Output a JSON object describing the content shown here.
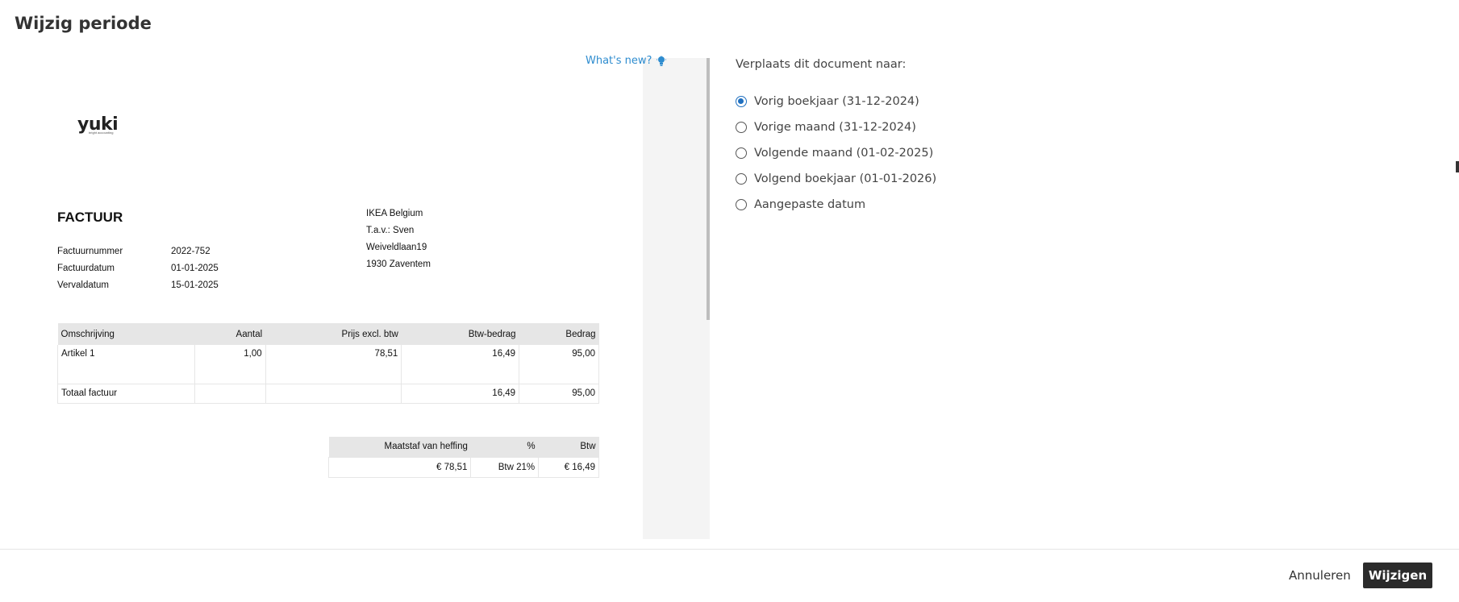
{
  "dialog": {
    "title": "Wijzig periode"
  },
  "whats_new": {
    "label": "What's new?",
    "icon": "lightbulb-icon"
  },
  "invoice": {
    "logo": "yuki",
    "logo_tagline": "bright accounting",
    "title": "FACTUUR",
    "meta": [
      {
        "key": "Factuurnummer",
        "value": "2022-752"
      },
      {
        "key": "Factuurdatum",
        "value": "01-01-2025"
      },
      {
        "key": "Vervaldatum",
        "value": "15-01-2025"
      }
    ],
    "address": [
      "IKEA Belgium",
      "T.a.v.: Sven",
      "Weiveldlaan19",
      "1930 Zaventem"
    ],
    "lines": {
      "headers": [
        "Omschrijving",
        "Aantal",
        "Prijs excl. btw",
        "Btw-bedrag",
        "Bedrag"
      ],
      "rows": [
        [
          "Artikel 1",
          "1,00",
          "78,51",
          "16,49",
          "95,00"
        ]
      ],
      "total": [
        "Totaal factuur",
        "",
        "",
        "16,49",
        "95,00"
      ]
    },
    "vat": {
      "headers": [
        "Maatstaf van heffing",
        "%",
        "Btw"
      ],
      "rows": [
        [
          "€ 78,51",
          "Btw 21%",
          "€ 16,49"
        ]
      ]
    }
  },
  "panel": {
    "label": "Verplaats dit document naar:",
    "options": [
      {
        "label": "Vorig boekjaar (31-12-2024)",
        "checked": true
      },
      {
        "label": "Vorige maand (31-12-2024)",
        "checked": false
      },
      {
        "label": "Volgende maand (01-02-2025)",
        "checked": false
      },
      {
        "label": "Volgend boekjaar (01-01-2026)",
        "checked": false
      },
      {
        "label": "Aangepaste datum",
        "checked": false
      }
    ]
  },
  "footer": {
    "cancel_label": "Annuleren",
    "confirm_label": "Wijzigen"
  },
  "colors": {
    "accent": "#1f6fbf",
    "link": "#2e8ccf",
    "primary_button": "#2b2b2b",
    "table_header": "#e6e6e6"
  }
}
